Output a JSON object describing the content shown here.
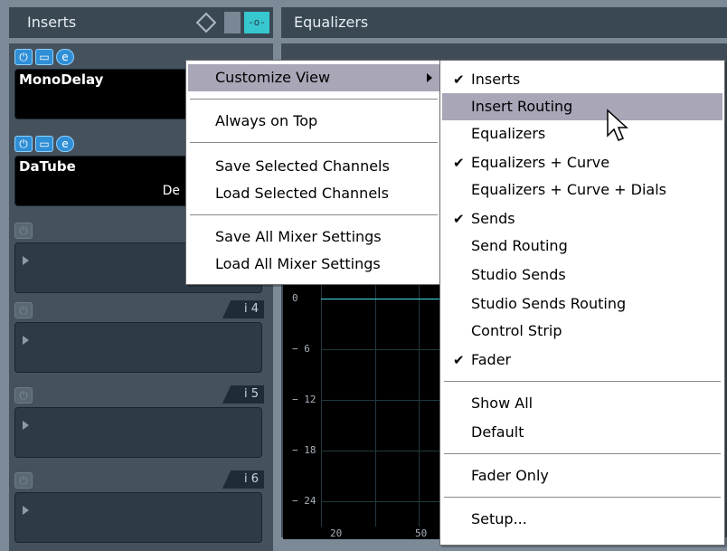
{
  "inserts_panel": {
    "title": "Inserts",
    "slots": [
      {
        "name": "MonoDelay",
        "sub": "",
        "active": true
      },
      {
        "name": "DaTube",
        "sub": "De",
        "active": true
      },
      {
        "name": "",
        "sub": "",
        "active": false
      },
      {
        "name": "",
        "sub": "",
        "active": false,
        "index": "i 4"
      },
      {
        "name": "",
        "sub": "",
        "active": false,
        "index": "i 5"
      },
      {
        "name": "",
        "sub": "",
        "active": false,
        "index": "i 6"
      }
    ],
    "header_icons": [
      "diamond-icon",
      "grey-toggle",
      "routing-icon"
    ],
    "routing_icon_text": "-o-"
  },
  "equalizers_panel": {
    "title": "Equalizers",
    "y_labels": [
      "0",
      "− 6",
      "− 12",
      "− 18",
      "− 24"
    ],
    "x_labels": [
      "20",
      "50"
    ]
  },
  "main_menu": {
    "items": [
      {
        "label": "Customize View",
        "has_submenu": true,
        "highlighted": true
      },
      {
        "label": "Always on Top"
      },
      {
        "label": "Save Selected Channels"
      },
      {
        "label": "Load Selected Channels"
      },
      {
        "label": "Save All Mixer Settings"
      },
      {
        "label": "Load All Mixer Settings"
      }
    ]
  },
  "sub_menu": {
    "items": [
      {
        "label": "Inserts",
        "checked": true
      },
      {
        "label": "Insert Routing",
        "checked": false,
        "highlighted": true
      },
      {
        "label": "Equalizers",
        "checked": false
      },
      {
        "label": "Equalizers + Curve",
        "checked": true
      },
      {
        "label": "Equalizers + Curve + Dials",
        "checked": false
      },
      {
        "label": "Sends",
        "checked": true
      },
      {
        "label": "Send Routing",
        "checked": false
      },
      {
        "label": "Studio Sends",
        "checked": false
      },
      {
        "label": "Studio Sends Routing",
        "checked": false
      },
      {
        "label": "Control Strip",
        "checked": false
      },
      {
        "label": "Fader",
        "checked": true
      },
      {
        "label": "Show All",
        "checked": false
      },
      {
        "label": "Default",
        "checked": false
      },
      {
        "label": "Fader Only",
        "checked": false
      },
      {
        "label": "Setup...",
        "checked": false
      }
    ],
    "check_glyph": "✔"
  },
  "colors": {
    "menu_highlight": "#a9a6b8",
    "accent_cyan": "#36c7cf",
    "power_blue": "#2f8fd6",
    "panel_dark": "#3a4854"
  }
}
